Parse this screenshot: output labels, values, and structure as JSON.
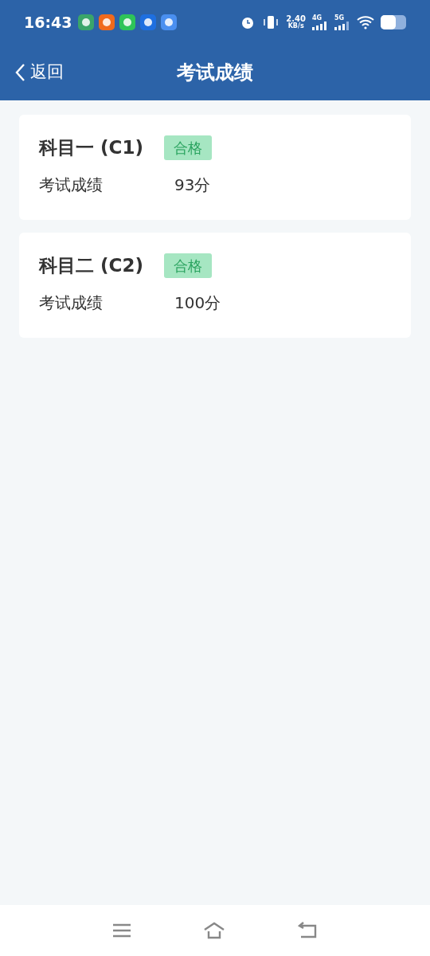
{
  "status_bar": {
    "time": "16:43",
    "speed": "2.40",
    "speed_unit": "KB/s",
    "net_1": "4G",
    "net_2": "5G"
  },
  "header": {
    "back": "返回",
    "title": "考试成绩"
  },
  "results": [
    {
      "subject": "科目一 (C1)",
      "tag": "合格",
      "label": "考试成绩",
      "score": "93分"
    },
    {
      "subject": "科目二 (C2)",
      "tag": "合格",
      "label": "考试成绩",
      "score": "100分"
    }
  ]
}
